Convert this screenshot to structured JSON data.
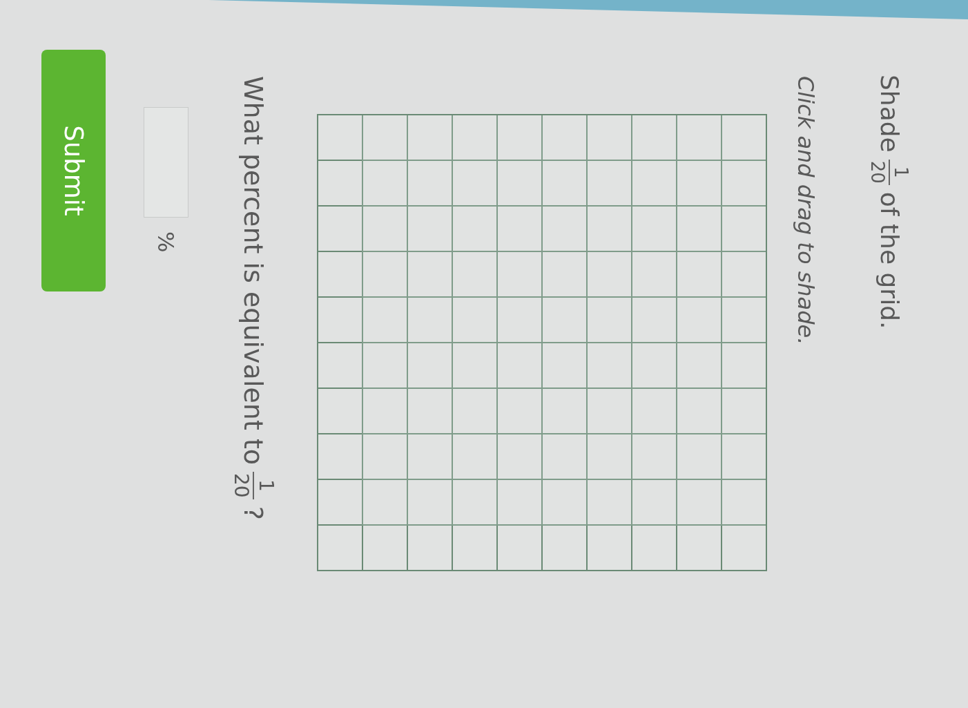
{
  "prompt": {
    "before": "Shade",
    "fraction": {
      "numerator": "1",
      "denominator": "20"
    },
    "after": "of the grid."
  },
  "instruction": "Click and drag to shade.",
  "grid": {
    "rows": [
      {
        "cells": [
          {
            "shaded": false
          },
          {
            "shaded": false
          },
          {
            "shaded": false
          },
          {
            "shaded": false
          },
          {
            "shaded": false
          },
          {
            "shaded": false
          },
          {
            "shaded": false
          },
          {
            "shaded": false
          },
          {
            "shaded": false
          },
          {
            "shaded": false
          }
        ]
      },
      {
        "cells": [
          {
            "shaded": false
          },
          {
            "shaded": false
          },
          {
            "shaded": false
          },
          {
            "shaded": false
          },
          {
            "shaded": false
          },
          {
            "shaded": false
          },
          {
            "shaded": false
          },
          {
            "shaded": false
          },
          {
            "shaded": false
          },
          {
            "shaded": false
          }
        ]
      },
      {
        "cells": [
          {
            "shaded": false
          },
          {
            "shaded": false
          },
          {
            "shaded": false
          },
          {
            "shaded": false
          },
          {
            "shaded": false
          },
          {
            "shaded": false
          },
          {
            "shaded": false
          },
          {
            "shaded": false
          },
          {
            "shaded": false
          },
          {
            "shaded": false
          }
        ]
      },
      {
        "cells": [
          {
            "shaded": false
          },
          {
            "shaded": false
          },
          {
            "shaded": false
          },
          {
            "shaded": false
          },
          {
            "shaded": false
          },
          {
            "shaded": false
          },
          {
            "shaded": false
          },
          {
            "shaded": false
          },
          {
            "shaded": false
          },
          {
            "shaded": false
          }
        ]
      },
      {
        "cells": [
          {
            "shaded": false
          },
          {
            "shaded": false
          },
          {
            "shaded": false
          },
          {
            "shaded": false
          },
          {
            "shaded": false
          },
          {
            "shaded": false
          },
          {
            "shaded": false
          },
          {
            "shaded": false
          },
          {
            "shaded": false
          },
          {
            "shaded": false
          }
        ]
      },
      {
        "cells": [
          {
            "shaded": false
          },
          {
            "shaded": false
          },
          {
            "shaded": false
          },
          {
            "shaded": false
          },
          {
            "shaded": false
          },
          {
            "shaded": false
          },
          {
            "shaded": false
          },
          {
            "shaded": false
          },
          {
            "shaded": false
          },
          {
            "shaded": false
          }
        ]
      },
      {
        "cells": [
          {
            "shaded": false
          },
          {
            "shaded": false
          },
          {
            "shaded": false
          },
          {
            "shaded": false
          },
          {
            "shaded": false
          },
          {
            "shaded": false
          },
          {
            "shaded": false
          },
          {
            "shaded": false
          },
          {
            "shaded": false
          },
          {
            "shaded": false
          }
        ]
      },
      {
        "cells": [
          {
            "shaded": false
          },
          {
            "shaded": false
          },
          {
            "shaded": false
          },
          {
            "shaded": false
          },
          {
            "shaded": false
          },
          {
            "shaded": false
          },
          {
            "shaded": false
          },
          {
            "shaded": false
          },
          {
            "shaded": false
          },
          {
            "shaded": false
          }
        ]
      },
      {
        "cells": [
          {
            "shaded": false
          },
          {
            "shaded": false
          },
          {
            "shaded": false
          },
          {
            "shaded": false
          },
          {
            "shaded": false
          },
          {
            "shaded": false
          },
          {
            "shaded": false
          },
          {
            "shaded": false
          },
          {
            "shaded": false
          },
          {
            "shaded": false
          }
        ]
      },
      {
        "cells": [
          {
            "shaded": false
          },
          {
            "shaded": false
          },
          {
            "shaded": false
          },
          {
            "shaded": false
          },
          {
            "shaded": false
          },
          {
            "shaded": false
          },
          {
            "shaded": false
          },
          {
            "shaded": false
          },
          {
            "shaded": false
          },
          {
            "shaded": false
          }
        ]
      }
    ]
  },
  "question": {
    "before": "What percent is equivalent to",
    "fraction": {
      "numerator": "1",
      "denominator": "20"
    },
    "after": "?"
  },
  "answer": {
    "unit": "%"
  },
  "submit_button": {
    "label": "Submit"
  }
}
